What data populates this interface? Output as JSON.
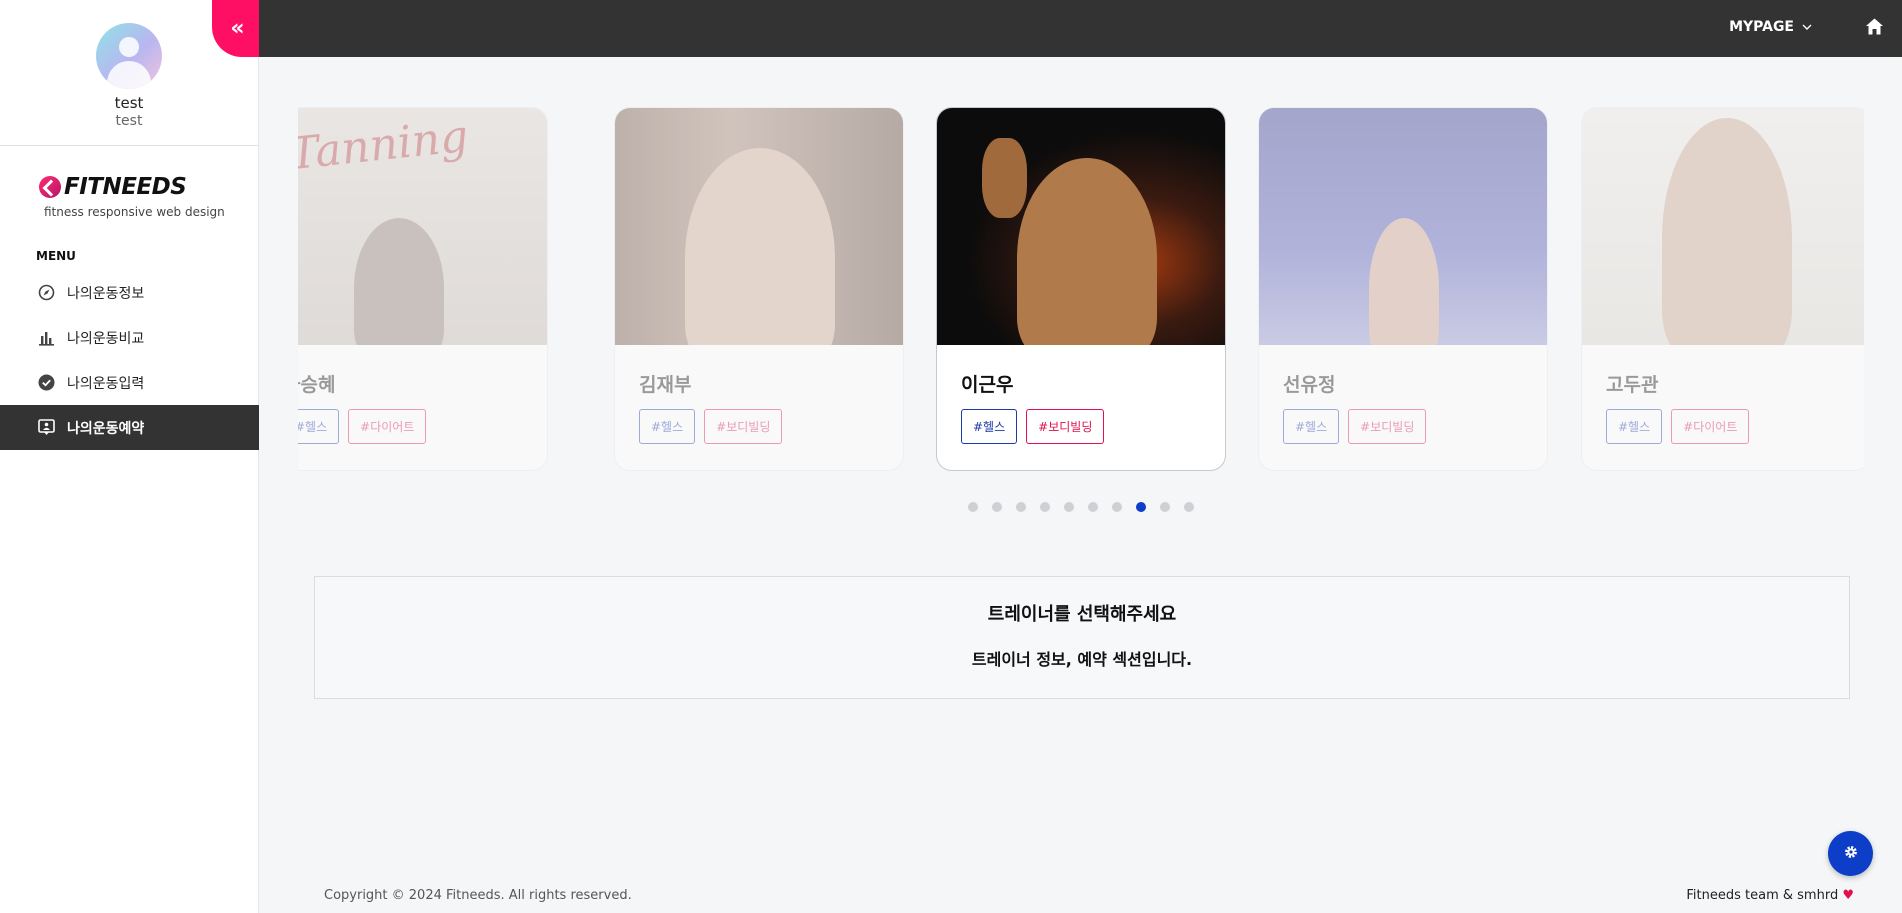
{
  "profile": {
    "name": "test",
    "sub": "test"
  },
  "brand": {
    "name": "FITNEEDS",
    "tagline": "fitness responsive web design"
  },
  "menu": {
    "title": "MENU",
    "items": [
      {
        "label": "나의운동정보",
        "icon": "compass-icon"
      },
      {
        "label": "나의운동비교",
        "icon": "bar-chart-icon"
      },
      {
        "label": "나의운동입력",
        "icon": "check-circle-icon"
      },
      {
        "label": "나의운동예약",
        "icon": "chat-person-icon",
        "active": true
      }
    ]
  },
  "topbar": {
    "mypage": "MYPAGE"
  },
  "trainers": [
    {
      "name": "하승혜",
      "tags": [
        "#헬스",
        "#다이어트"
      ]
    },
    {
      "name": "김재부",
      "tags": [
        "#헬스",
        "#보디빌딩"
      ]
    },
    {
      "name": "이근우",
      "tags": [
        "#헬스",
        "#보디빌딩"
      ]
    },
    {
      "name": "선유정",
      "tags": [
        "#헬스",
        "#보디빌딩"
      ]
    },
    {
      "name": "고두관",
      "tags": [
        "#헬스",
        "#다이어트"
      ]
    }
  ],
  "carousel": {
    "dot_count": 10,
    "active_dot_index": 7,
    "active_card_index": 2
  },
  "info": {
    "title": "트레이너를 선택해주세요",
    "subtitle": "트레이너 정보, 예약 섹션입니다."
  },
  "footer": {
    "copyright": "Copyright © 2024 Fitneeds. All rights reserved.",
    "team": "Fitneeds team & smhrd"
  },
  "colors": {
    "accent_pink": "#ff0f63",
    "accent_blue": "#0d3ec8",
    "topbar": "#333333"
  }
}
